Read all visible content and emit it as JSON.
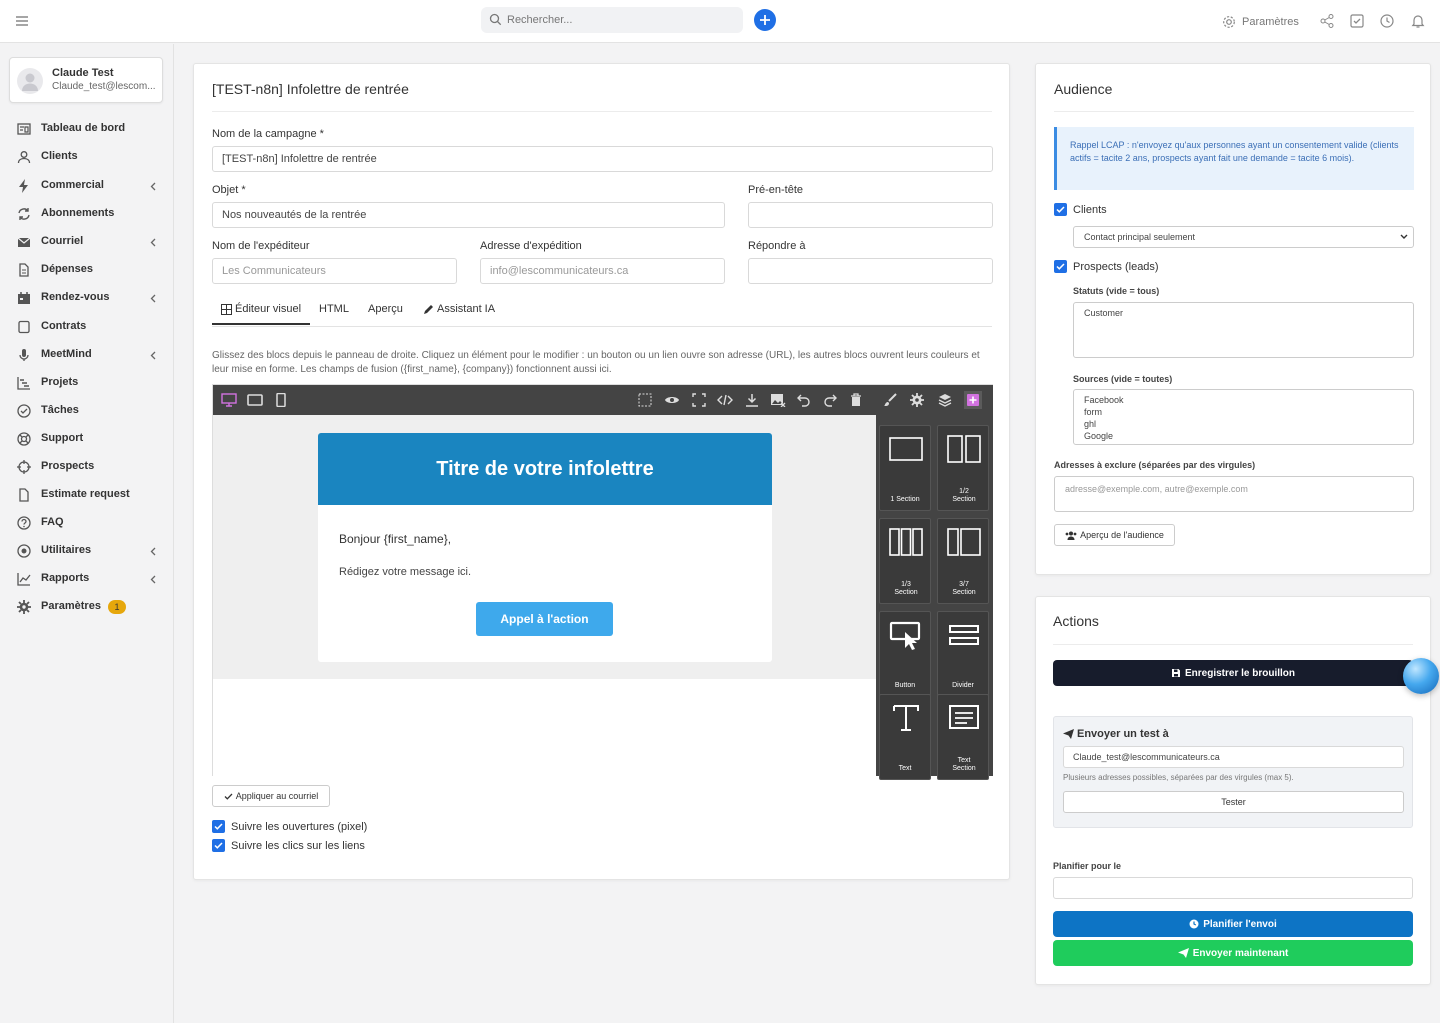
{
  "topbar": {
    "search_placeholder": "Rechercher...",
    "settings_label": "Paramètres"
  },
  "user": {
    "name": "Claude Test",
    "email": "Claude_test@lescom..."
  },
  "sidebar": {
    "items": [
      {
        "label": "Tableau de bord",
        "icon": "dashboard-icon",
        "chevron": false
      },
      {
        "label": "Clients",
        "icon": "user-icon",
        "chevron": false
      },
      {
        "label": "Commercial",
        "icon": "bolt-icon",
        "chevron": true
      },
      {
        "label": "Abonnements",
        "icon": "refresh-icon",
        "chevron": false
      },
      {
        "label": "Courriel",
        "icon": "envelope-icon",
        "chevron": true
      },
      {
        "label": "Dépenses",
        "icon": "file-icon",
        "chevron": false
      },
      {
        "label": "Rendez-vous",
        "icon": "calendar-icon",
        "chevron": true
      },
      {
        "label": "Contrats",
        "icon": "contract-icon",
        "chevron": false
      },
      {
        "label": "MeetMind",
        "icon": "microphone-icon",
        "chevron": true
      },
      {
        "label": "Projets",
        "icon": "gantt-icon",
        "chevron": false
      },
      {
        "label": "Tâches",
        "icon": "check-circle-icon",
        "chevron": false
      },
      {
        "label": "Support",
        "icon": "lifebuoy-icon",
        "chevron": false
      },
      {
        "label": "Prospects",
        "icon": "crosshair-icon",
        "chevron": false
      },
      {
        "label": "Estimate request",
        "icon": "document-icon",
        "chevron": false
      },
      {
        "label": "FAQ",
        "icon": "question-icon",
        "chevron": false
      },
      {
        "label": "Utilitaires",
        "icon": "dot-circle-icon",
        "chevron": true
      },
      {
        "label": "Rapports",
        "icon": "chart-icon",
        "chevron": true
      },
      {
        "label": "Paramètres",
        "icon": "cog-icon",
        "chevron": false,
        "badge": "1"
      }
    ]
  },
  "campaign": {
    "title": "[TEST-n8n] Infolettre de rentrée",
    "name_label": "Nom de la campagne *",
    "name_value": "[TEST-n8n] Infolettre de rentrée",
    "subject_label": "Objet *",
    "subject_value": "Nos nouveautés de la rentrée",
    "preheader_label": "Pré-en-tête",
    "preheader_value": "",
    "sender_name_label": "Nom de l'expéditeur",
    "sender_name_placeholder": "Les Communicateurs",
    "sender_email_label": "Adresse d'expédition",
    "sender_email_placeholder": "info@lescommunicateurs.ca",
    "reply_to_label": "Répondre à",
    "reply_to_value": "",
    "tabs": [
      "Éditeur visuel",
      "HTML",
      "Aperçu",
      "Assistant IA"
    ],
    "help_text": "Glissez des blocs depuis le panneau de droite. Cliquez un élément pour le modifier : un bouton ou un lien ouvre son adresse (URL), les autres blocs ouvrent leurs couleurs et leur mise en forme. Les champs de fusion ({first_name}, {company}) fonctionnent aussi ici.",
    "apply_button": "Appliquer au courriel",
    "track_opens": "Suivre les ouvertures (pixel)",
    "track_clicks": "Suivre les clics sur les liens"
  },
  "email_preview": {
    "header_title": "Titre de votre infolettre",
    "greeting": "Bonjour {first_name},",
    "message": "Rédigez votre message ici.",
    "cta_label": "Appel à l'action",
    "header_color": "#1a85c0",
    "cta_color": "#3ea9ec"
  },
  "blocks": [
    {
      "label": "1 Section"
    },
    {
      "label": "1/2 Section"
    },
    {
      "label": "1/3 Section"
    },
    {
      "label": "3/7 Section"
    },
    {
      "label": "Button"
    },
    {
      "label": "Divider"
    },
    {
      "label": "Text"
    },
    {
      "label": "Text Section"
    }
  ],
  "audience": {
    "title": "Audience",
    "notice": "Rappel LCAP : n'envoyez qu'aux personnes ayant un consentement valide (clients actifs = tacite 2 ans, prospects ayant fait une demande = tacite 6 mois).",
    "clients_label": "Clients",
    "clients_select": "Contact principal seulement",
    "prospects_label": "Prospects (leads)",
    "statuses_label": "Statuts (vide = tous)",
    "statuses_options": [
      "Customer"
    ],
    "sources_label": "Sources (vide = toutes)",
    "sources_options": [
      "Facebook",
      "form",
      "ghl",
      "Google"
    ],
    "exclude_label": "Adresses à exclure (séparées par des virgules)",
    "exclude_placeholder": "adresse@exemple.com, autre@exemple.com",
    "preview_button": "Aperçu de l'audience"
  },
  "actions": {
    "title": "Actions",
    "save_draft": "Enregistrer le brouillon",
    "send_test_title": "Envoyer un test à",
    "test_email": "Claude_test@lescommunicateurs.ca",
    "test_hint": "Plusieurs adresses possibles, séparées par des virgules (max 5).",
    "test_button": "Tester",
    "schedule_label": "Planifier pour le",
    "schedule_value": "",
    "schedule_button": "Planifier l'envoi",
    "send_now_button": "Envoyer maintenant"
  }
}
